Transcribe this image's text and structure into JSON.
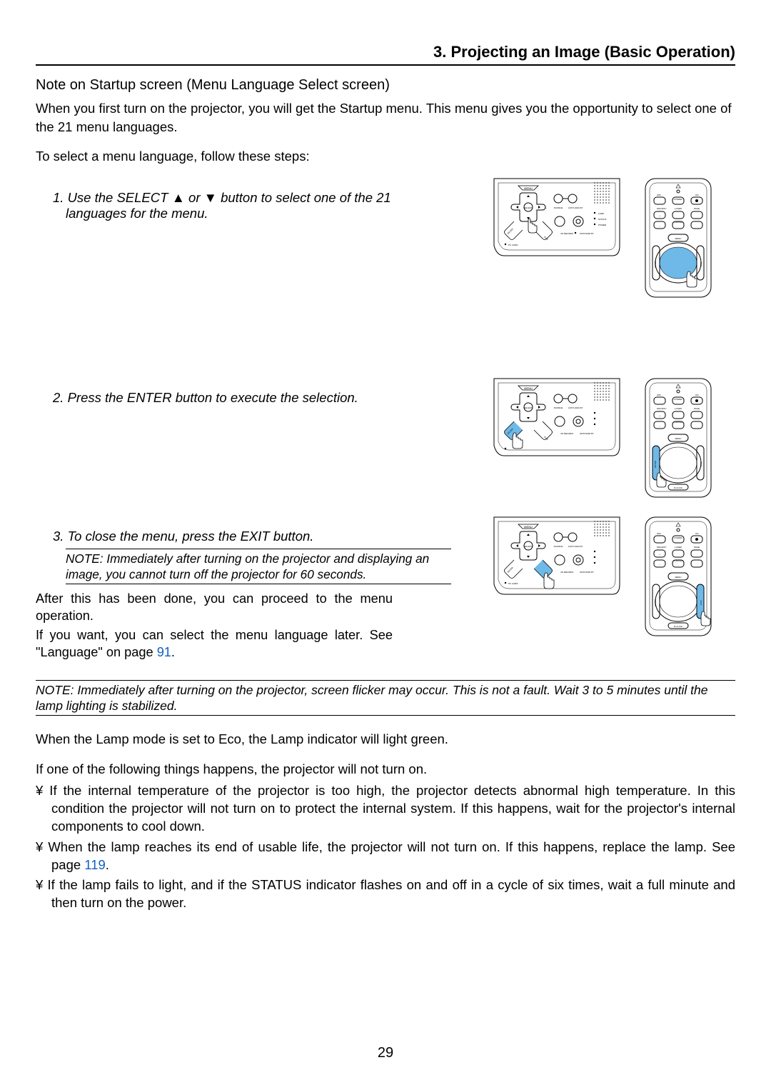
{
  "header": {
    "section": "3. Projecting an Image (Basic Operation)"
  },
  "startup": {
    "heading": "Note on Startup screen (Menu Language Select screen)",
    "intro": "When you first turn on the projector, you will get the Startup menu. This menu gives you the opportunity to select one of the 21 menu languages.",
    "lead": "To select a menu language, follow these steps:"
  },
  "steps": {
    "s1a": "1.  Use the SELECT ",
    "s1b": " or ",
    "s1c": " button to select one of the 21 languages for the menu.",
    "s2": "2.  Press the ENTER button to execute the selection.",
    "s3": "3.  To close the menu, press the EXIT button."
  },
  "note1": "NOTE: Immediately after turning on the projector and displaying an image, you cannot turn off the projector for 60 seconds.",
  "after": {
    "p1": "After this has been done, you can proceed to the menu operation.",
    "p2a": "If you want, you can select the menu language later. See \"Language\" on page ",
    "p2link": "91",
    "p2b": "."
  },
  "wide_note": "NOTE: Immediately after turning on the projector, screen flicker may occur. This is not a fault. Wait 3 to 5 minutes until the lamp lighting is stabilized.",
  "eco": "When the Lamp mode is set to Eco, the Lamp indicator will light green.",
  "wontturn": {
    "lead": "If one of the following things happens, the projector will not turn on.",
    "b1": "¥  If the internal temperature of the projector is too high, the projector detects abnormal high temperature. In this condition the projector will not turn on to protect the internal system. If this happens, wait for the projector's internal components to cool down.",
    "b2a": "¥  When the lamp reaches its end of usable life, the projector will not turn on. If this happens, replace the lamp. See page ",
    "b2link": "119",
    "b2b": ".",
    "b3": "¥  If the lamp fails to light, and if the STATUS indicator flashes on and off in a cycle of six times, wait a full minute and then turn on the power."
  },
  "pagenum": "29",
  "panel": {
    "MENU": "MENU",
    "SELECT": "SELECT",
    "SOURCE": "SOURCE",
    "AUTO_ADJUST": "AUTO ADJUST",
    "ENTER": "ENTER",
    "EXIT": "EXIT",
    "REFORM": "3D REFORM",
    "ONSTAND": "ON/STAND BY",
    "PCCARD": "PC CARD",
    "LAMP": "LAMP",
    "STATUS": "STATUS",
    "POWER": "POWER"
  },
  "remote": {
    "OFF": "OFF",
    "ON": "ON",
    "POWER": "POWER",
    "MAGNIFY": "MAGNIFY",
    "LASER": "LASER",
    "PAGE": "PAGE",
    "POINTER": "POINTER",
    "MENU": "MENU",
    "ENTER": "ENTER",
    "EXIT": "EXIT",
    "RCLICK": "R-CLICK"
  }
}
